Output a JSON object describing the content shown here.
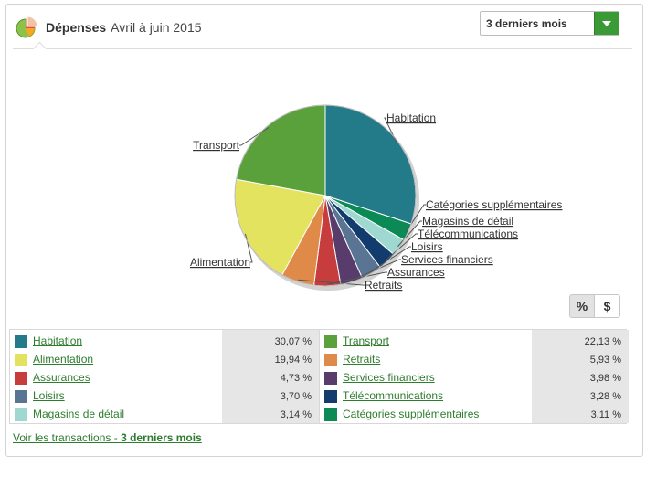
{
  "header": {
    "title": "Dépenses",
    "period": "Avril à juin 2015",
    "icon": "pie-chart-icon"
  },
  "period_select": {
    "value": "3 derniers mois"
  },
  "toggle": {
    "percent": "%",
    "amount": "$"
  },
  "chart_data": {
    "type": "pie",
    "slices": [
      {
        "label": "Habitation",
        "value": 30.07,
        "color": "#237b8a"
      },
      {
        "label": "Catégories supplémentaires",
        "value": 3.11,
        "color": "#0b8a55"
      },
      {
        "label": "Magasins de détail",
        "value": 3.14,
        "color": "#9ed8d1"
      },
      {
        "label": "Télécommunications",
        "value": 3.28,
        "color": "#113c6d"
      },
      {
        "label": "Loisirs",
        "value": 3.7,
        "color": "#5a7593"
      },
      {
        "label": "Services financiers",
        "value": 3.98,
        "color": "#583d6c"
      },
      {
        "label": "Assurances",
        "value": 4.73,
        "color": "#c73d3d"
      },
      {
        "label": "Retraits",
        "value": 5.93,
        "color": "#e08a4a"
      },
      {
        "label": "Alimentation",
        "value": 19.94,
        "color": "#e3e35f"
      },
      {
        "label": "Transport",
        "value": 22.13,
        "color": "#5aa13c"
      }
    ]
  },
  "legend": {
    "left": [
      {
        "name": "Habitation",
        "pct": "30,07 %",
        "color": "#237b8a"
      },
      {
        "name": "Alimentation",
        "pct": "19,94 %",
        "color": "#e3e35f"
      },
      {
        "name": "Assurances",
        "pct": "4,73 %",
        "color": "#c73d3d"
      },
      {
        "name": "Loisirs",
        "pct": "3,70 %",
        "color": "#5a7593"
      },
      {
        "name": "Magasins de détail",
        "pct": "3,14 %",
        "color": "#9ed8d1"
      }
    ],
    "right": [
      {
        "name": "Transport",
        "pct": "22,13 %",
        "color": "#5aa13c"
      },
      {
        "name": "Retraits",
        "pct": "5,93 %",
        "color": "#e08a4a"
      },
      {
        "name": "Services financiers",
        "pct": "3,98 %",
        "color": "#583d6c"
      },
      {
        "name": "Télécommunications",
        "pct": "3,28 %",
        "color": "#113c6d"
      },
      {
        "name": "Catégories supplémentaires",
        "pct": "3,11 %",
        "color": "#0b8a55"
      }
    ]
  },
  "footer": {
    "link_text": "Voir les transactions - ",
    "link_bold": "3 derniers mois"
  }
}
